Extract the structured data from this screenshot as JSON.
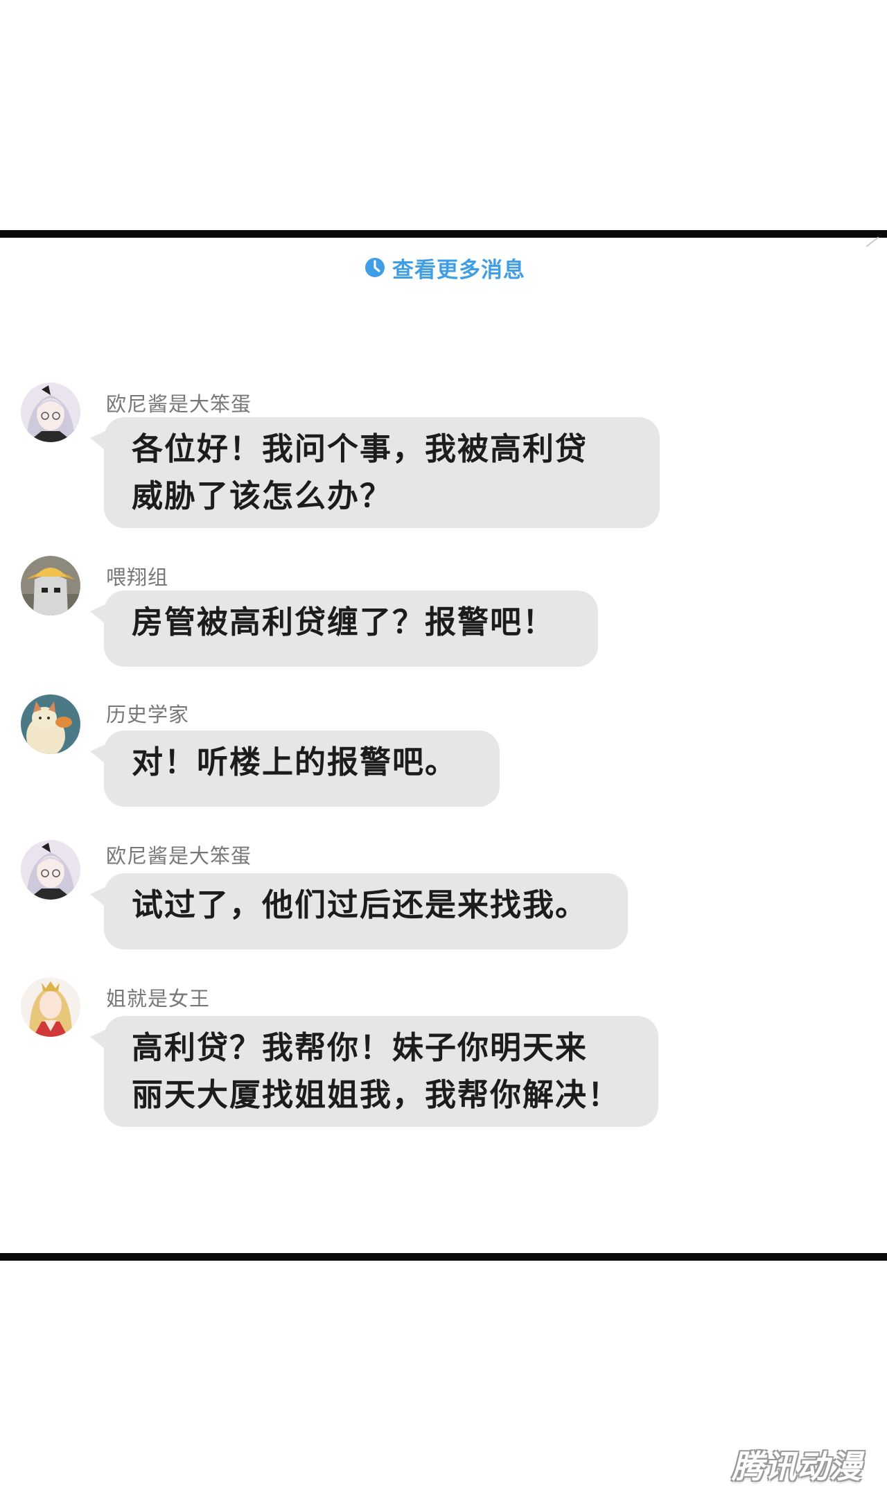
{
  "header": {
    "load_more_label": "查看更多消息",
    "icon": "clock-icon",
    "accent_color": "#3f9ee6"
  },
  "messages": [
    {
      "sender": "欧尼酱是大笨蛋",
      "avatar": "avatar-silver-hair-girl",
      "lines": [
        "各位好！我问个事，我被高利贷",
        "威胁了该怎么办？"
      ]
    },
    {
      "sender": "喂翔组",
      "avatar": "avatar-ghost-hat",
      "lines": [
        "房管被高利贷缠了？报警吧！"
      ]
    },
    {
      "sender": "历史学家",
      "avatar": "avatar-cat-with-fish",
      "lines": [
        "对！听楼上的报警吧。"
      ]
    },
    {
      "sender": "欧尼酱是大笨蛋",
      "avatar": "avatar-silver-hair-girl",
      "lines": [
        "试过了，他们过后还是来找我。"
      ]
    },
    {
      "sender": "姐就是女王",
      "avatar": "avatar-blonde-queen",
      "lines": [
        "高利贷？我帮你！妹子你明天来",
        "丽天大厦找姐姐我，我帮你解决！"
      ]
    }
  ],
  "watermark": {
    "text": "腾讯动漫"
  },
  "colors": {
    "bubble": "#e6e6e6",
    "sender_text": "#777777",
    "message_text": "#1c1c1c",
    "divider": "#0a0a0a"
  }
}
